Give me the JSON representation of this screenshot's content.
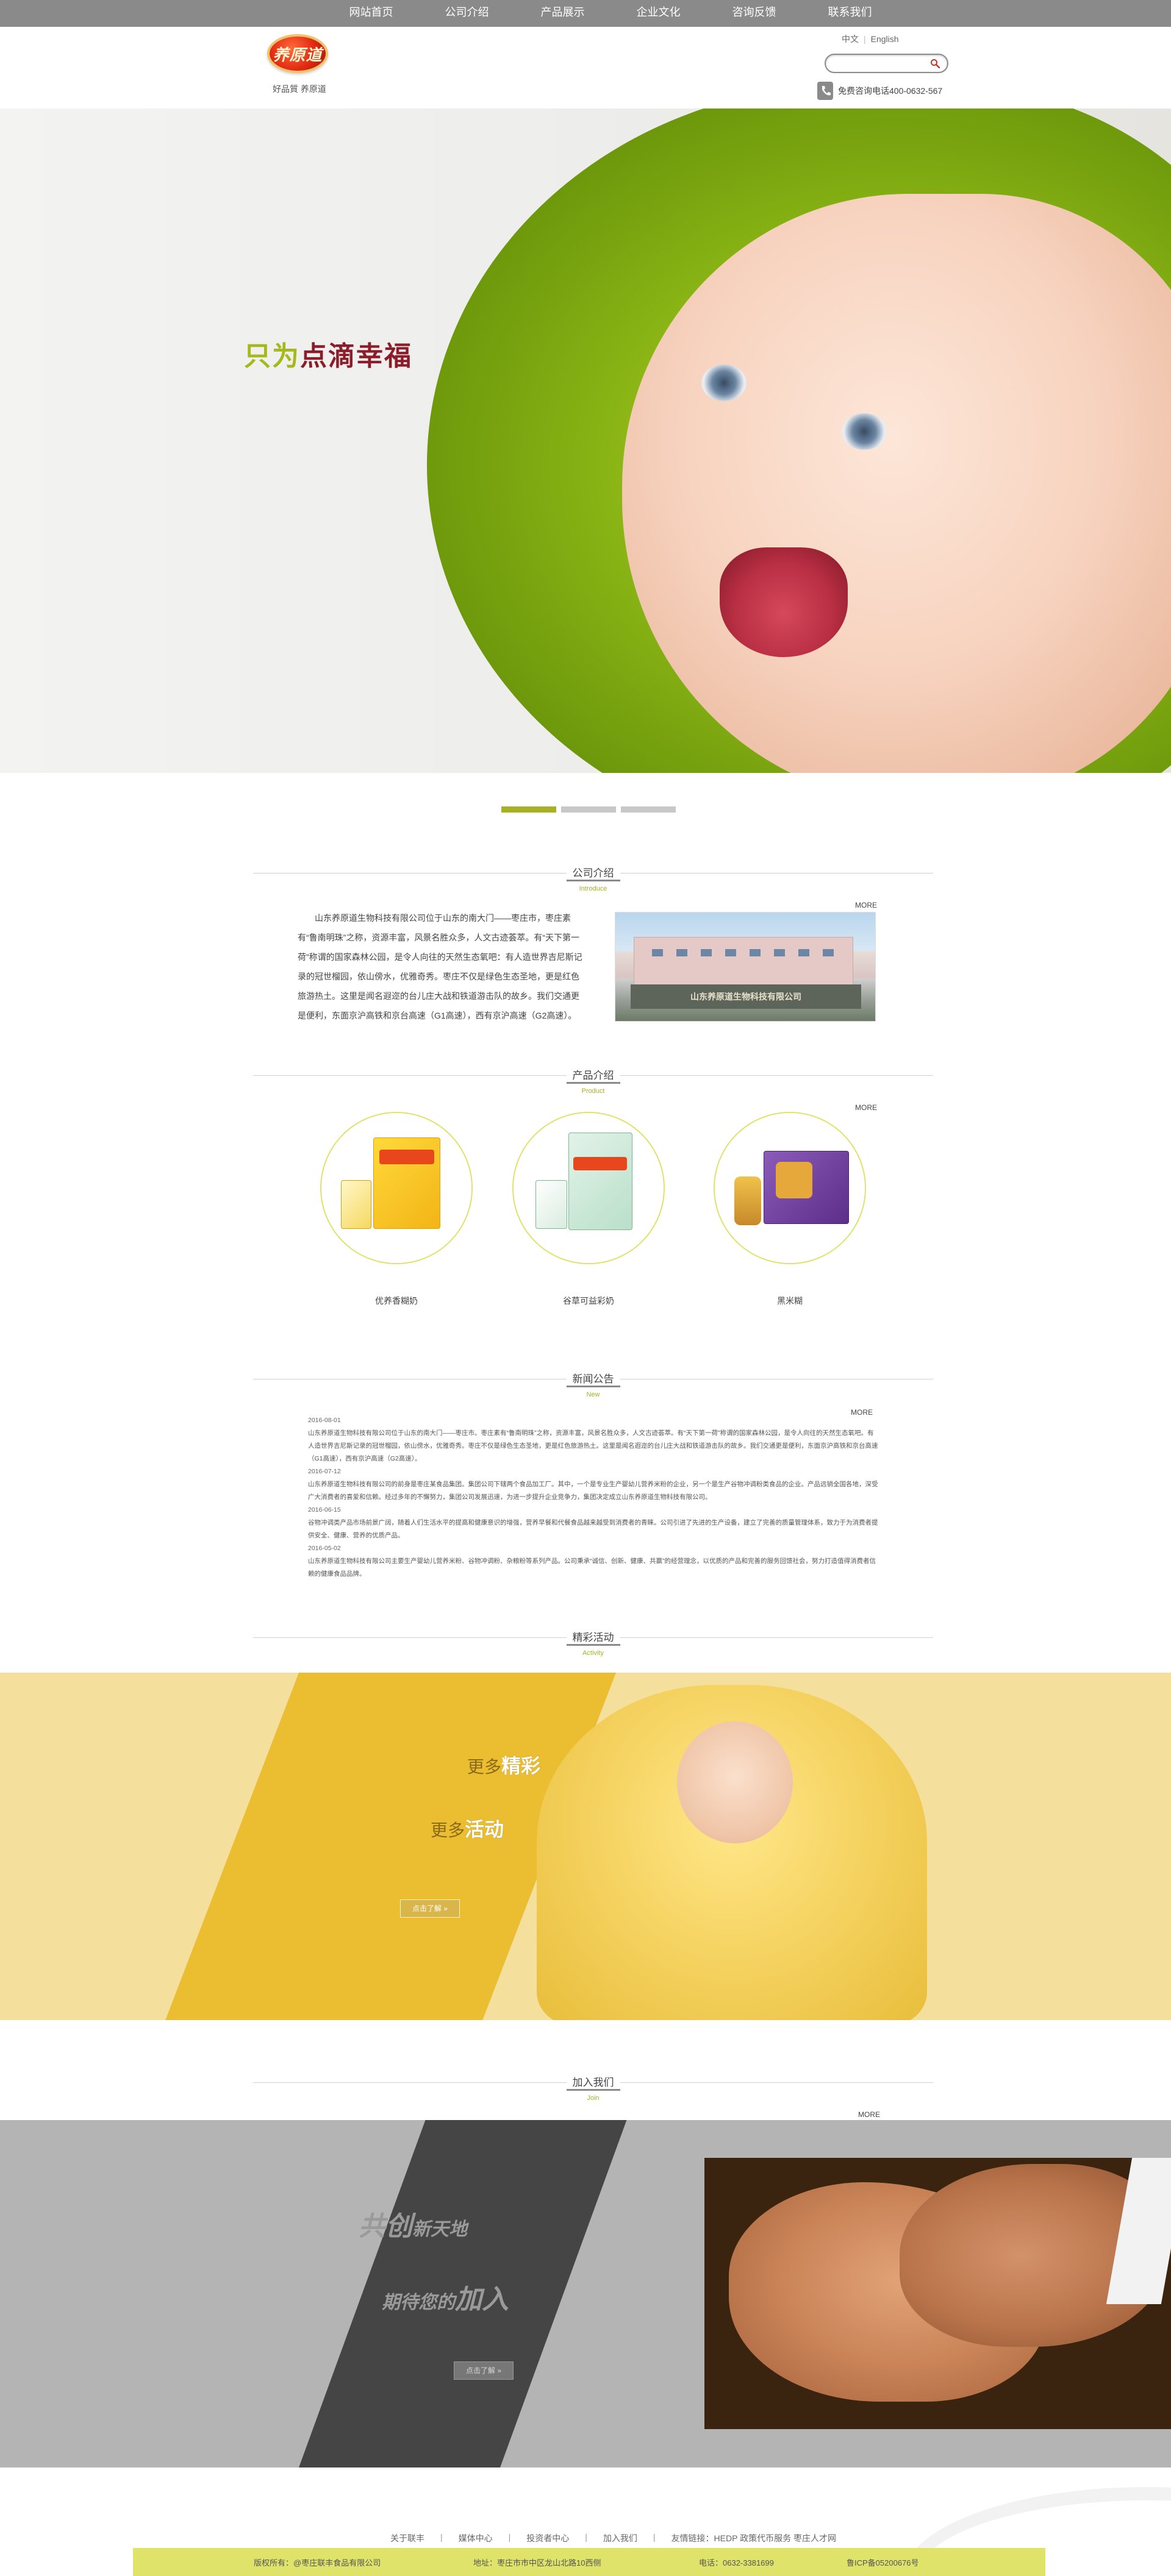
{
  "nav": [
    "网站首页",
    "公司介绍",
    "产品展示",
    "企业文化",
    "咨询反馈",
    "联系我们"
  ],
  "header": {
    "logo_text": "养原道",
    "slogan": "好品質 养原道",
    "lang_cn": "中文",
    "lang_en": "English",
    "search_placeholder": "",
    "phone": "免费咨询电话400-0632-567"
  },
  "hero": {
    "title_green": "只为",
    "title_red": "点滴幸福",
    "slides": 3,
    "active_slide": 1
  },
  "intro": {
    "title": "公司介绍",
    "subtitle": "Introduce",
    "more": "MORE",
    "text": "山东养原道生物科技有限公司位于山东的南大门——枣庄市，枣庄素有“鲁南明珠”之称，资源丰富，风景名胜众多，人文古迹荟萃。有“天下第一荷”称谓的国家森林公园，是令人向往的天然生态氧吧：有人造世界吉尼斯记录的冠世榴园，依山傍水，优雅奇秀。枣庄不仅是绿色生态圣地，更是红色旅游热土。这里是闻名遐迩的台儿庄大战和铁道游击队的故乡。我们交通更是便利，东面京沪高铁和京台高速（G1高速），西有京沪高速（G2高速）。",
    "sign_text": "山东养原道生物科技有限公司"
  },
  "products": {
    "title": "产品介绍",
    "subtitle": "Product",
    "more": "MORE",
    "items": [
      {
        "name": "优养香糊奶"
      },
      {
        "name": "谷草可益彩奶"
      },
      {
        "name": "黑米糊"
      }
    ]
  },
  "news": {
    "title": "新闻公告",
    "subtitle": "New",
    "more": "MORE",
    "items": [
      {
        "date": "2016-08-01",
        "text": "山东养原道生物科技有限公司位于山东的南大门——枣庄市。枣庄素有“鲁南明珠”之称，资源丰富，风景名胜众多，人文古迹荟萃。有“天下第一荷”称谓的国家森林公园，是令人向往的天然生态氧吧。有人造世界吉尼斯记录的冠世榴园，依山傍水，优雅奇秀。枣庄不仅是绿色生态圣地，更是红色旅游热土。这里是闻名遐迩的台儿庄大战和铁道游击队的故乡。我们交通更是便利，东面京沪高铁和京台高速（G1高速），西有京沪高速（G2高速）。"
      },
      {
        "date": "2016-07-12",
        "text": "山东养原道生物科技有限公司的前身是枣庄某食品集团。集团公司下辖两个食品加工厂。其中，一个是专业生产婴幼儿营养米粉的企业，另一个是生产谷物冲调粉类食品的企业。产品远销全国各地，深受广大消费者的喜爱和信赖。经过多年的不懈努力，集团公司发展迅速，为进一步提升企业竞争力，集团决定成立山东养原道生物科技有限公司。"
      },
      {
        "date": "2016-06-15",
        "text": "谷物冲调类产品市场前景广阔，随着人们生活水平的提高和健康意识的增强，营养早餐和代餐食品越来越受到消费者的青睐。公司引进了先进的生产设备，建立了完善的质量管理体系，致力于为消费者提供安全、健康、营养的优质产品。"
      },
      {
        "date": "2016-05-02",
        "text": "山东养原道生物科技有限公司主要生产婴幼儿营养米粉、谷物冲调粉、杂粮粉等系列产品。公司秉承“诚信、创新、健康、共赢”的经营理念，以优质的产品和完善的服务回馈社会，努力打造值得消费者信赖的健康食品品牌。"
      }
    ]
  },
  "activity": {
    "title": "精彩活动",
    "subtitle": "Activity",
    "line1_small": "更多",
    "line1_big": "精彩",
    "line2_small": "更多",
    "line2_big": "活动",
    "button": "点击了解 »"
  },
  "join": {
    "title": "加入我们",
    "subtitle": "Join",
    "more": "MORE",
    "line1_big": "共创",
    "line1_small": "新天地",
    "line2_small": "期待您的",
    "line2_big": "加入",
    "button": "点击了解 »"
  },
  "footer": {
    "links": [
      "关于联丰",
      "媒体中心",
      "投资者中心",
      "加入我们",
      "友情链接：HEDP 政策代币服务 枣庄人才网"
    ],
    "copyright": "版权所有：@枣庄联丰食品有限公司",
    "address": "地址：枣庄市市中区龙山北路10西侧",
    "tel": "电话：0632-3381699",
    "icp": "鲁ICP备05200676号"
  },
  "colors": {
    "accent_green": "#a6b222",
    "accent_red": "#8b1d2b",
    "nav_gray": "#8a8a8a",
    "activity_yellow": "#f4df9c",
    "footer_bar": "#dfe36a"
  }
}
